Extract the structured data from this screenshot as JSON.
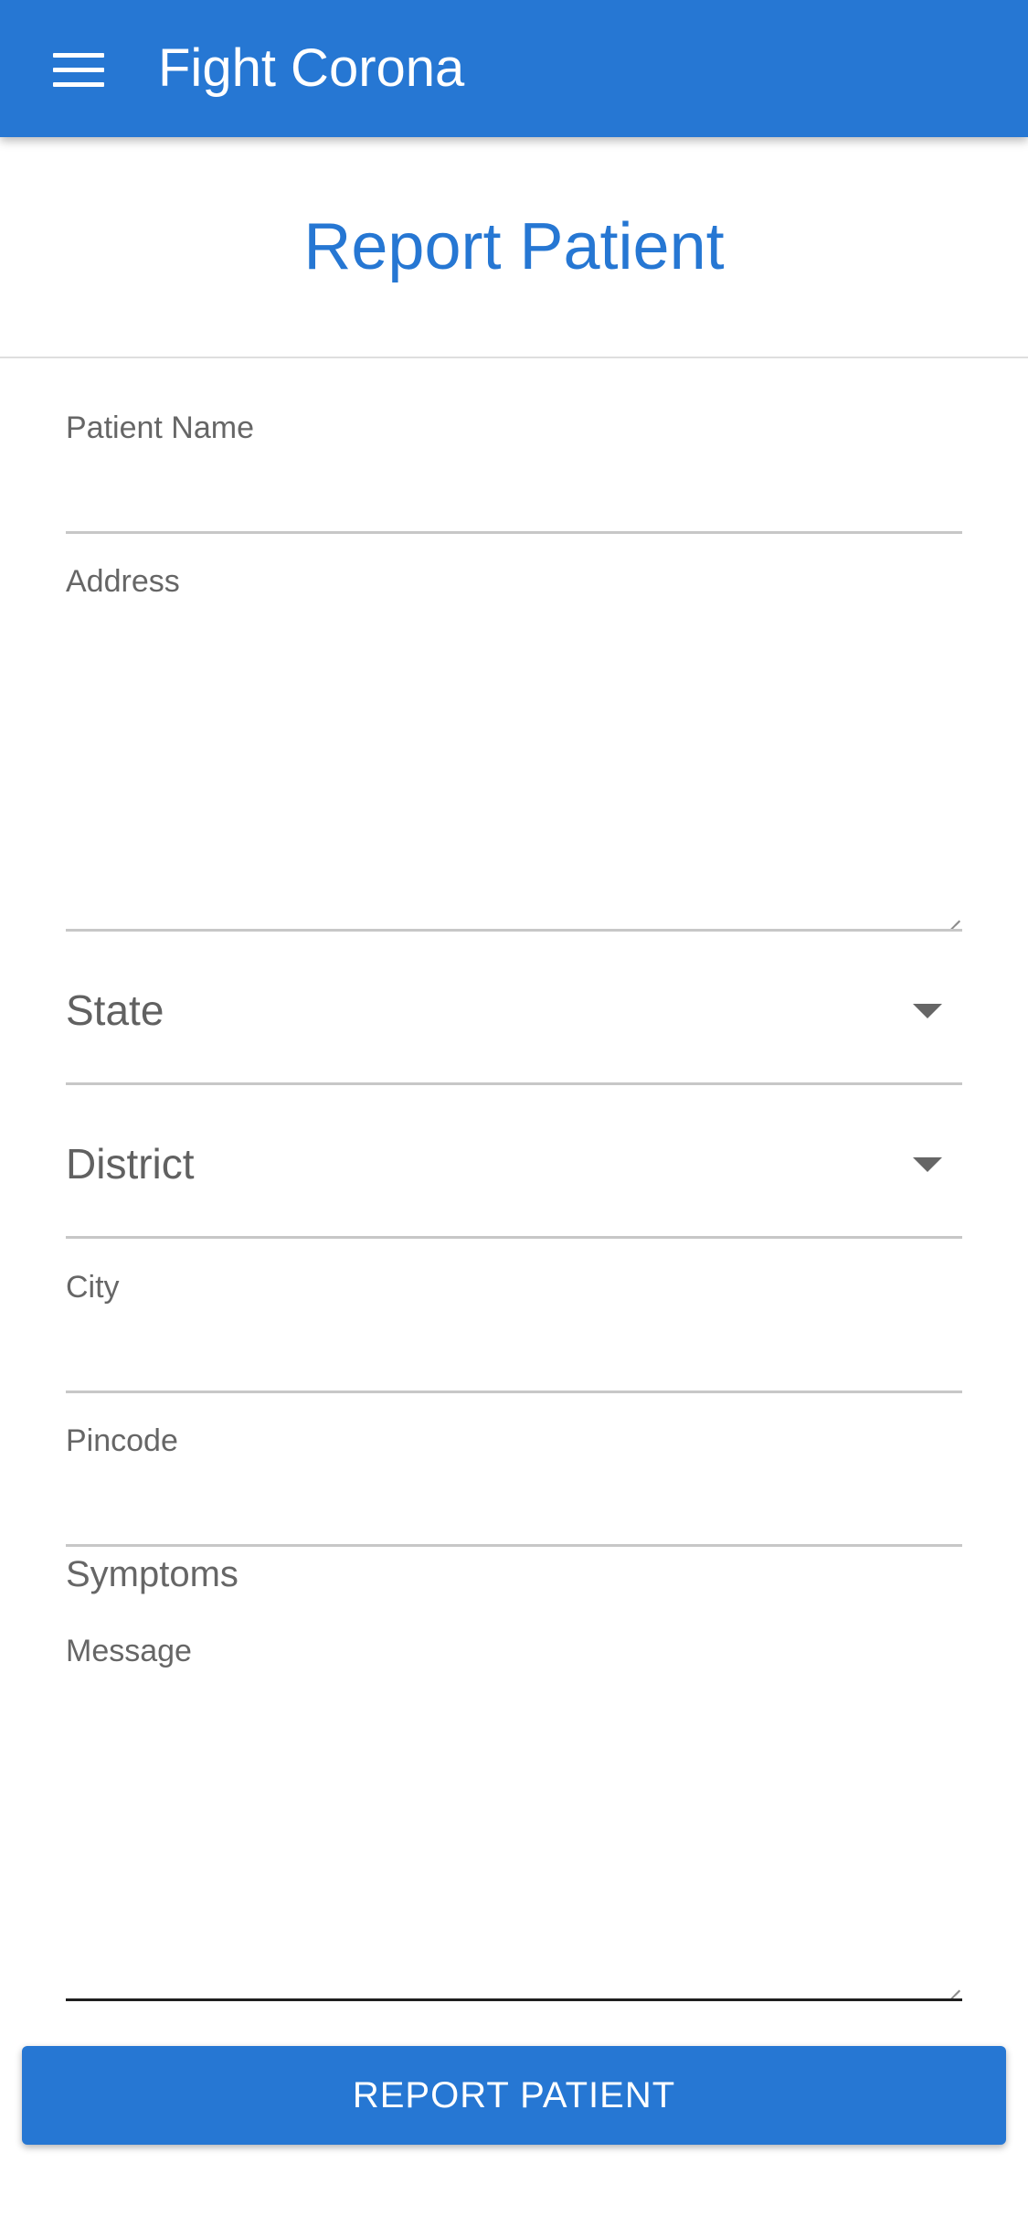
{
  "app_bar": {
    "menu_icon": "hamburger-menu-icon",
    "title": "Fight Corona",
    "background_color": "#2677d3"
  },
  "page": {
    "title": "Report Patient"
  },
  "form": {
    "patient_name": {
      "label": "Patient Name",
      "value": ""
    },
    "address": {
      "label": "Address",
      "value": ""
    },
    "state": {
      "label": "State",
      "icon": "dropdown-arrow-icon"
    },
    "district": {
      "label": "District",
      "icon": "dropdown-arrow-icon"
    },
    "city": {
      "label": "City",
      "value": ""
    },
    "pincode": {
      "label": "Pincode",
      "value": ""
    },
    "symptoms_heading": "Symptoms",
    "message": {
      "label": "Message",
      "value": ""
    }
  },
  "actions": {
    "submit_label": "REPORT PATIENT"
  }
}
